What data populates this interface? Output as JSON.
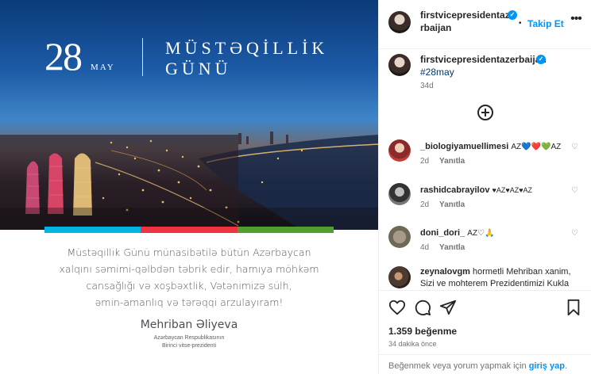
{
  "post": {
    "hero": {
      "day": "28",
      "month": "MAY",
      "line1": "MÜSTƏQİLLİK",
      "line2": "GÜNÜ"
    },
    "flag_colors": [
      "#00b5e2",
      "#ef3340",
      "#509e2f"
    ],
    "message_lines": [
      "Müstəqillik Günü münasibətilə bütün Azərbaycan",
      "xalqını səmimi-qəlbdən təbrik edir, hamıya möhkəm",
      "cansağlığı və xoşbəxtlik, Vətənimizə sülh,",
      "əmin-amanlıq və tərəqqi arzulayıram!"
    ],
    "signature": {
      "name": "Mehriban Əliyeva",
      "title_line1": "Azərbaycan Respublikasının",
      "title_line2": "Birinci vitse-prezidenti"
    }
  },
  "header": {
    "username": "firstvicepresidentazerbaijan",
    "follow_label": "Takip Et",
    "dot": "•",
    "more_icon": "more-horizontal-icon"
  },
  "caption": {
    "username": "firstvicepresidentazerbaijan",
    "text": "#28may",
    "time": "34d"
  },
  "comments": [
    {
      "username": "_biologiyamuellimesi",
      "text": "AZ💙❤️💚AZ",
      "time": "2d",
      "reply_label": "Yanıtla",
      "avatar": "red"
    },
    {
      "username": "rashidcabrayilov",
      "text": "♥AZ♥AZ♥AZ",
      "time": "2d",
      "reply_label": "Yanıtla",
      "avatar": "mono"
    },
    {
      "username": "doni_dori_",
      "text": "AZ♡🙏",
      "time": "4d",
      "reply_label": "Yanıtla",
      "avatar": "dog"
    },
    {
      "username": "zeynalovgm",
      "text": "hormetli Mehriban xanim, Sizi ve mohterem Prezidentimizi Kukla",
      "time": "",
      "reply_label": "",
      "avatar": "grp"
    }
  ],
  "actions": {
    "icons": [
      "heart-icon",
      "comment-icon",
      "share-icon",
      "bookmark-icon"
    ],
    "likes": "1.359 beğenme",
    "time_ago": "34 dakika önce"
  },
  "login_bar": {
    "prefix": "Beğenmek veya yorum yapmak için ",
    "link": "giriş yap",
    "suffix": "."
  }
}
